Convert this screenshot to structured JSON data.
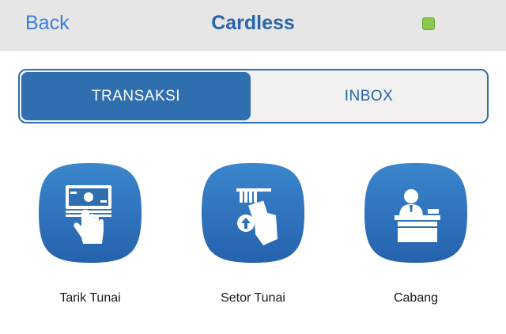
{
  "navbar": {
    "back_label": "Back",
    "title": "Cardless"
  },
  "segment": {
    "tabs": [
      {
        "label": "TRANSAKSI",
        "active": true
      },
      {
        "label": "INBOX",
        "active": false
      }
    ]
  },
  "menu": {
    "items": [
      {
        "label": "Tarik Tunai",
        "icon": "cash-withdrawal-icon"
      },
      {
        "label": "Setor Tunai",
        "icon": "cash-deposit-icon"
      },
      {
        "label": "Cabang",
        "icon": "branch-teller-icon"
      }
    ]
  },
  "colors": {
    "accent": "#2f6fb0",
    "icon_gradient_top": "#3a86cc",
    "icon_gradient_bottom": "#2662ad",
    "status": "#8cc84b",
    "link": "#3d7fd6"
  }
}
